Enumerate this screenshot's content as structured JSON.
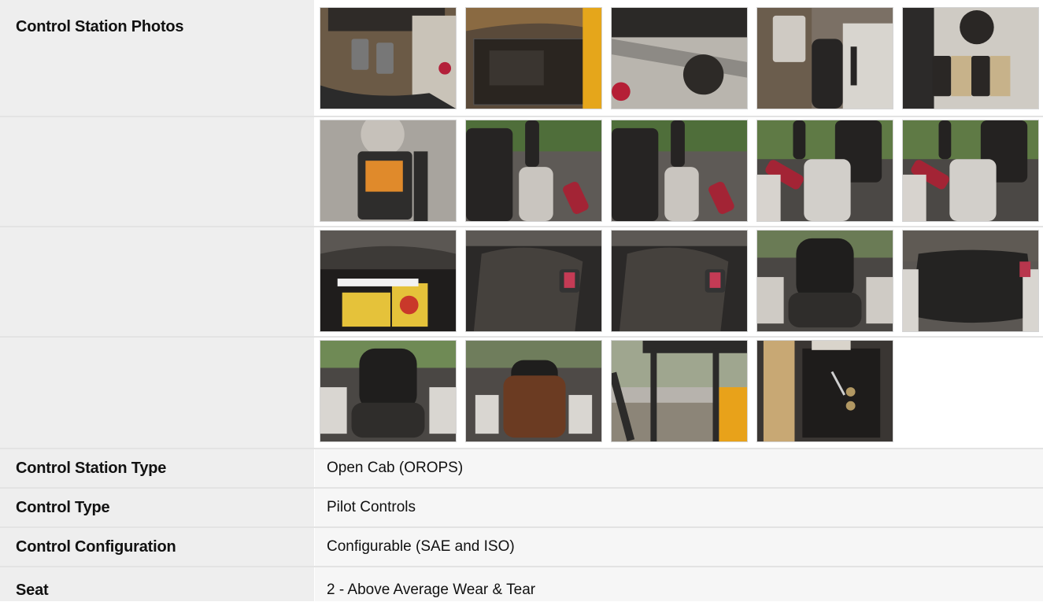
{
  "photos_row": {
    "label": "Control Station Photos",
    "rows": [
      [
        {
          "name": "photo-pedals-floor",
          "bg": "#6b5a46",
          "a": "#2f2b28",
          "b": "#c9c3b8",
          "shape": "pedals"
        },
        {
          "name": "photo-panel-seat-edge",
          "bg": "#5a4a3a",
          "a": "#2a2520",
          "b": "#8a6a42",
          "shape": "panel"
        },
        {
          "name": "photo-knob",
          "bg": "#b9b5ae",
          "a": "#2d2a27",
          "b": "#d9d6d0",
          "shape": "knob"
        },
        {
          "name": "photo-joystick-console",
          "bg": "#7b7065",
          "a": "#272524",
          "b": "#d8d5cf",
          "shape": "joystick"
        },
        {
          "name": "photo-switch-panel",
          "bg": "#cfcbc4",
          "a": "#2a2725",
          "b": "#c7b28a",
          "shape": "switches"
        }
      ],
      [
        {
          "name": "photo-display-monitor",
          "bg": "#9a9690",
          "a": "#2e2d2c",
          "b": "#e08a2b",
          "shape": "monitor"
        },
        {
          "name": "photo-left-joystick-1",
          "bg": "#4f6e3a",
          "a": "#262423",
          "b": "#c9c5bf",
          "shape": "joystick2"
        },
        {
          "name": "photo-left-joystick-2",
          "bg": "#4f6e3a",
          "a": "#262423",
          "b": "#c9c5bf",
          "shape": "joystick2"
        },
        {
          "name": "photo-right-joystick-1",
          "bg": "#5f7a45",
          "a": "#242221",
          "b": "#d2cfca",
          "shape": "joystick3"
        },
        {
          "name": "photo-right-joystick-2",
          "bg": "#5f7a45",
          "a": "#242221",
          "b": "#d2cfca",
          "shape": "joystick3"
        }
      ],
      [
        {
          "name": "photo-under-seat-decals",
          "bg": "#3d3a37",
          "a": "#1f1d1c",
          "b": "#e5c23a",
          "shape": "decal"
        },
        {
          "name": "photo-seat-belt-1",
          "bg": "#4a4643",
          "a": "#2b2928",
          "b": "#c43b55",
          "shape": "seat"
        },
        {
          "name": "photo-seat-belt-2",
          "bg": "#4a4643",
          "a": "#2b2928",
          "b": "#c43b55",
          "shape": "seat"
        },
        {
          "name": "photo-seat-front",
          "bg": "#6a7b55",
          "a": "#1f1e1d",
          "b": "#cfcbc5",
          "shape": "seatfront"
        },
        {
          "name": "photo-seat-cushion",
          "bg": "#5b5753",
          "a": "#242322",
          "b": "#d8d5d0",
          "shape": "cushion"
        }
      ],
      [
        {
          "name": "photo-seat-overview",
          "bg": "#6f8a55",
          "a": "#1f1e1d",
          "b": "#d9d6d1",
          "shape": "seatfront"
        },
        {
          "name": "photo-seat-cover",
          "bg": "#6f7d5c",
          "a": "#6b3b22",
          "b": "#d9d6d1",
          "shape": "seatcover"
        },
        {
          "name": "photo-canopy-exterior",
          "bg": "#b7b3ad",
          "a": "#2b2a29",
          "b": "#e8a21a",
          "shape": "canopy"
        },
        {
          "name": "photo-rear-access",
          "bg": "#3a3633",
          "a": "#1e1c1b",
          "b": "#c8a874",
          "shape": "access"
        }
      ]
    ]
  },
  "specs": [
    {
      "name": "control-station-type",
      "label": "Control Station Type",
      "value": "Open Cab (OROPS)"
    },
    {
      "name": "control-type",
      "label": "Control Type",
      "value": "Pilot Controls"
    },
    {
      "name": "control-configuration",
      "label": "Control Configuration",
      "value": "Configurable (SAE and ISO)"
    },
    {
      "name": "seat",
      "label": "Seat",
      "value": "2 - Above Average Wear & Tear"
    }
  ]
}
